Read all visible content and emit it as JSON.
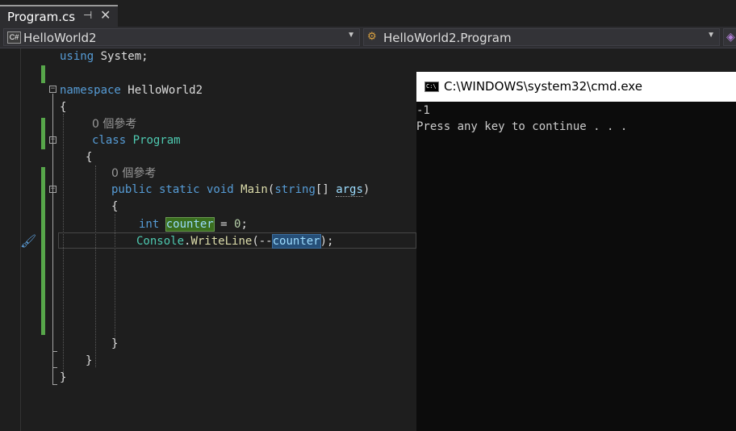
{
  "tab": {
    "title": "Program.cs",
    "pin_icon": "pin-icon",
    "close_icon": "close-icon"
  },
  "navbar": {
    "project": "HelloWorld2",
    "class": "HelloWorld2.Program",
    "project_icon": "csharp-project-icon",
    "class_icon": "class-icon"
  },
  "code": {
    "using_kw": "using",
    "using_ns": " System;",
    "namespace_kw": "namespace",
    "namespace_name": " HelloWorld2",
    "brace_open": "{",
    "brace_close": "}",
    "refs_class": "0 個參考",
    "class_kw": "class",
    "class_name": " Program",
    "refs_method": "0 個參考",
    "mods": "public static void",
    "method_name": " Main",
    "paren_open": "(",
    "string_kw": "string",
    "array": "[] ",
    "args": "args",
    "paren_close": ")",
    "int_kw": "int",
    "counter": "counter",
    "assign": " = ",
    "zero": "0",
    "semicolon": ";",
    "console": "Console",
    "dot": ".",
    "writeline": "WriteLine",
    "open_decr": "(--",
    "close_call": ");"
  },
  "console": {
    "title": "C:\\WINDOWS\\system32\\cmd.exe",
    "icon_text": "C:\\",
    "line1": "-1",
    "line2": "Press any key to continue . . ."
  }
}
